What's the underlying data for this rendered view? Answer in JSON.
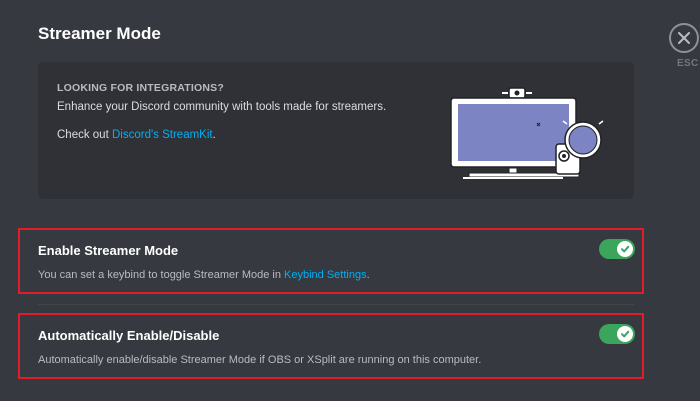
{
  "page": {
    "title": "Streamer Mode"
  },
  "close": {
    "esc_label": "ESC",
    "icon": "close-icon"
  },
  "promo": {
    "heading": "LOOKING FOR INTEGRATIONS?",
    "description": "Enhance your Discord community with tools made for streamers.",
    "link_prefix": "Check out ",
    "link_text": "Discord's StreamKit",
    "link_suffix": "."
  },
  "settings": [
    {
      "title": "Enable Streamer Mode",
      "note_prefix": "You can set a keybind to toggle Streamer Mode in ",
      "note_link": "Keybind Settings",
      "note_suffix": ".",
      "enabled": true
    },
    {
      "title": "Automatically Enable/Disable",
      "note": "Automatically enable/disable Streamer Mode if OBS or XSplit are running on this computer.",
      "enabled": true
    }
  ],
  "colors": {
    "background": "#36393f",
    "panel": "#2f3136",
    "accent_link": "#00b0f4",
    "toggle_on": "#3ba55c",
    "highlight_border": "#e01e2b"
  }
}
